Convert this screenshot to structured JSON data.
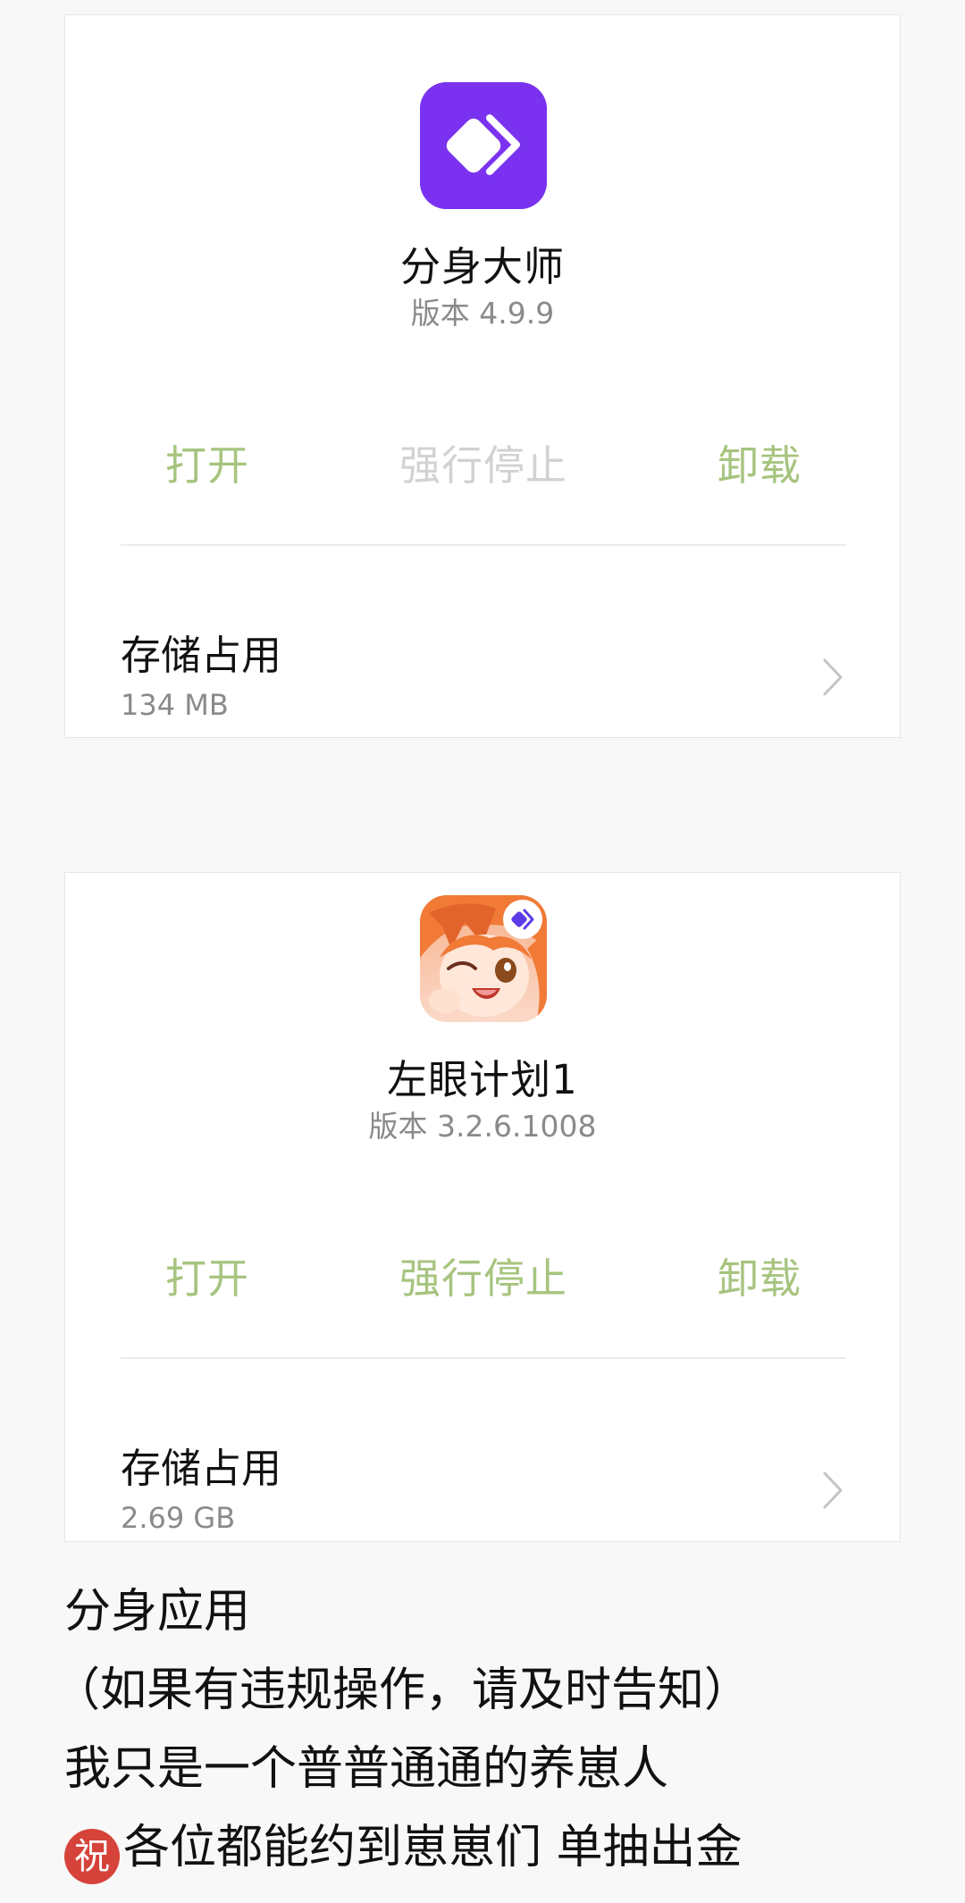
{
  "apps": [
    {
      "name": "分身大师",
      "version": "版本 4.9.9",
      "icon": "clone-diamond-icon",
      "icon_color": "#7a32f0",
      "actions": {
        "open": "打开",
        "force_stop": "强行停止",
        "uninstall": "卸载"
      },
      "force_stop_enabled": false,
      "storage_label": "存储占用",
      "storage_value": "134 MB"
    },
    {
      "name": "左眼计划1",
      "version": "版本 3.2.6.1008",
      "icon": "anime-character-icon",
      "badge_icon": "clone-badge-icon",
      "actions": {
        "open": "打开",
        "force_stop": "强行停止",
        "uninstall": "卸载"
      },
      "force_stop_enabled": true,
      "storage_label": "存储占用",
      "storage_value": "2.69 GB"
    }
  ],
  "caption": {
    "line1": "分身应用",
    "line2": "（如果有违规操作，请及时告知）",
    "line3": "我只是一个普普通通的养崽人",
    "line4_emoji": "祝",
    "line4_text": "各位都能约到崽崽们 单抽出金"
  },
  "colors": {
    "action_enabled": "#a7c47f",
    "action_disabled": "#d2d2d2",
    "background": "#f8f8f8",
    "card": "#ffffff"
  }
}
